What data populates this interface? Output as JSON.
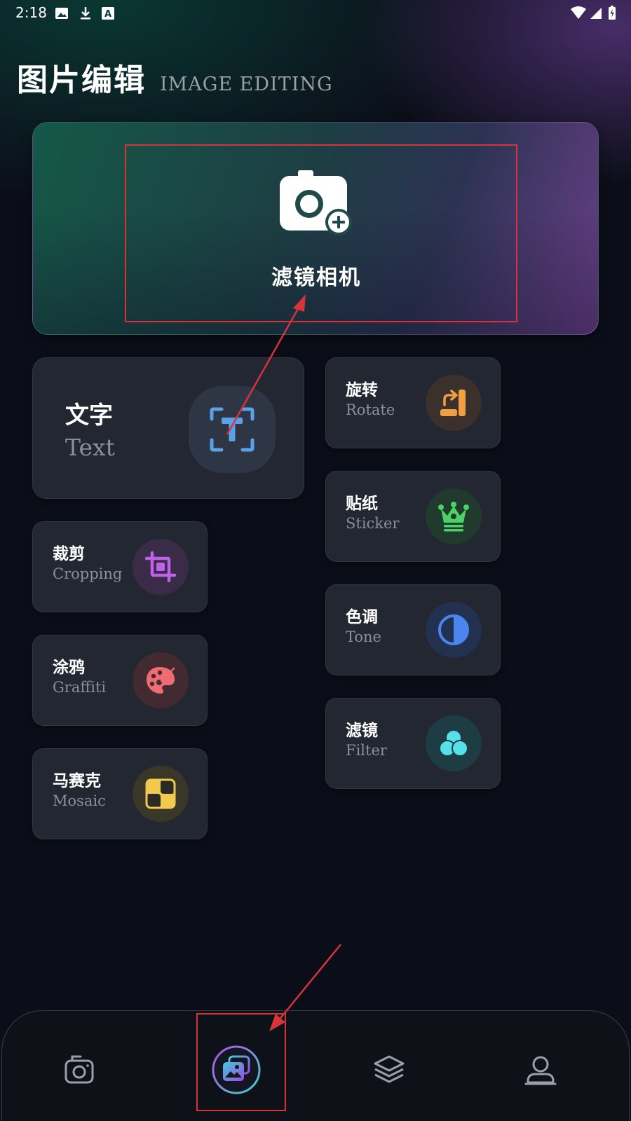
{
  "status_bar": {
    "time": "2:18"
  },
  "header": {
    "title": "图片编辑",
    "subtitle": "IMAGE EDITING"
  },
  "hero": {
    "label": "滤镜相机",
    "icon": "camera-plus-icon"
  },
  "tools": {
    "text": {
      "cn": "文字",
      "en": "Text",
      "icon": "text-scan-icon",
      "color": "#5aa2e8"
    },
    "rotate": {
      "cn": "旋转",
      "en": "Rotate",
      "icon": "rotate-icon",
      "color": "#f0a040"
    },
    "sticker": {
      "cn": "贴纸",
      "en": "Sticker",
      "icon": "crown-icon",
      "color": "#4cd264"
    },
    "crop": {
      "cn": "裁剪",
      "en": "Cropping",
      "icon": "crop-icon",
      "color": "#c062e8"
    },
    "tone": {
      "cn": "色调",
      "en": "Tone",
      "icon": "half-circle-icon",
      "color": "#4b86f0"
    },
    "graffiti": {
      "cn": "涂鸦",
      "en": "Graffiti",
      "icon": "palette-icon",
      "color": "#ef6d72"
    },
    "filter": {
      "cn": "滤镜",
      "en": "Filter",
      "icon": "filter-circles-icon",
      "color": "#56e0e8"
    },
    "mosaic": {
      "cn": "马赛克",
      "en": "Mosaic",
      "icon": "mosaic-icon",
      "color": "#f2c94c"
    }
  },
  "bottom_nav": [
    {
      "icon": "camera-icon",
      "active": false
    },
    {
      "icon": "gallery-icon",
      "active": true
    },
    {
      "icon": "layers-icon",
      "active": false
    },
    {
      "icon": "profile-icon",
      "active": false
    }
  ],
  "colors": {
    "annotation": "#d6343a",
    "card": "#232732",
    "background": "#0b0e18"
  }
}
